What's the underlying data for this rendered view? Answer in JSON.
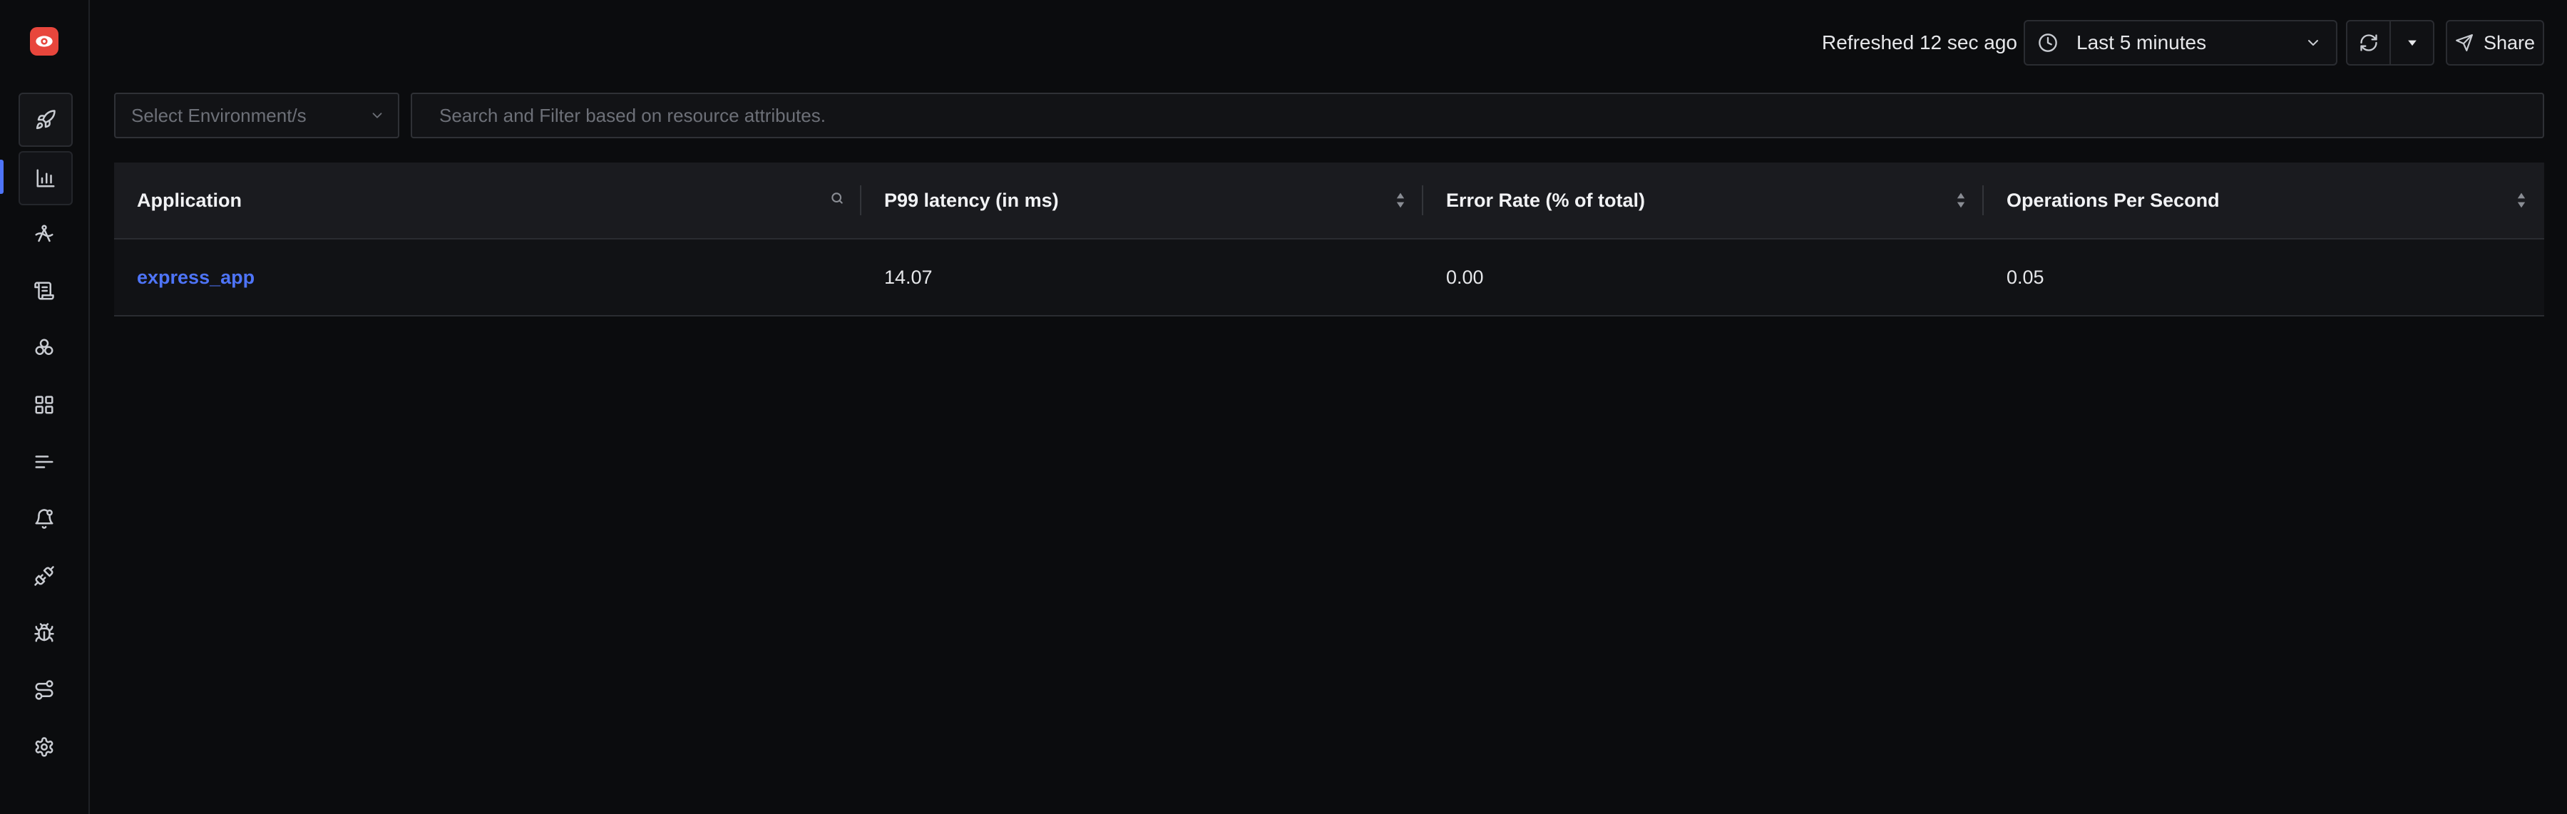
{
  "header": {
    "refreshed_text": "Refreshed 12 sec ago",
    "time_range": "Last 5 minutes",
    "share_label": "Share"
  },
  "filters": {
    "environment_placeholder": "Select Environment/s",
    "search_placeholder": "Search and Filter based on resource attributes."
  },
  "table": {
    "columns": [
      "Application",
      "P99 latency (in ms)",
      "Error Rate (% of total)",
      "Operations Per Second"
    ],
    "rows": [
      {
        "application": "express_app",
        "p99": "14.07",
        "error_rate": "0.00",
        "ops": "0.05"
      }
    ]
  },
  "colors": {
    "accent": "#4e74f8",
    "logo": "#e8463c",
    "background": "#0b0c0e"
  },
  "sidebar": {
    "icons": [
      "rocket-icon",
      "bar-chart-icon",
      "traces-icon",
      "logs-icon",
      "infrastructure-icon",
      "dashboards-icon",
      "messaging-queues-icon",
      "alerts-icon",
      "integrations-icon",
      "exceptions-icon",
      "pipelines-icon",
      "settings-icon"
    ],
    "active": "bar-chart-icon"
  }
}
